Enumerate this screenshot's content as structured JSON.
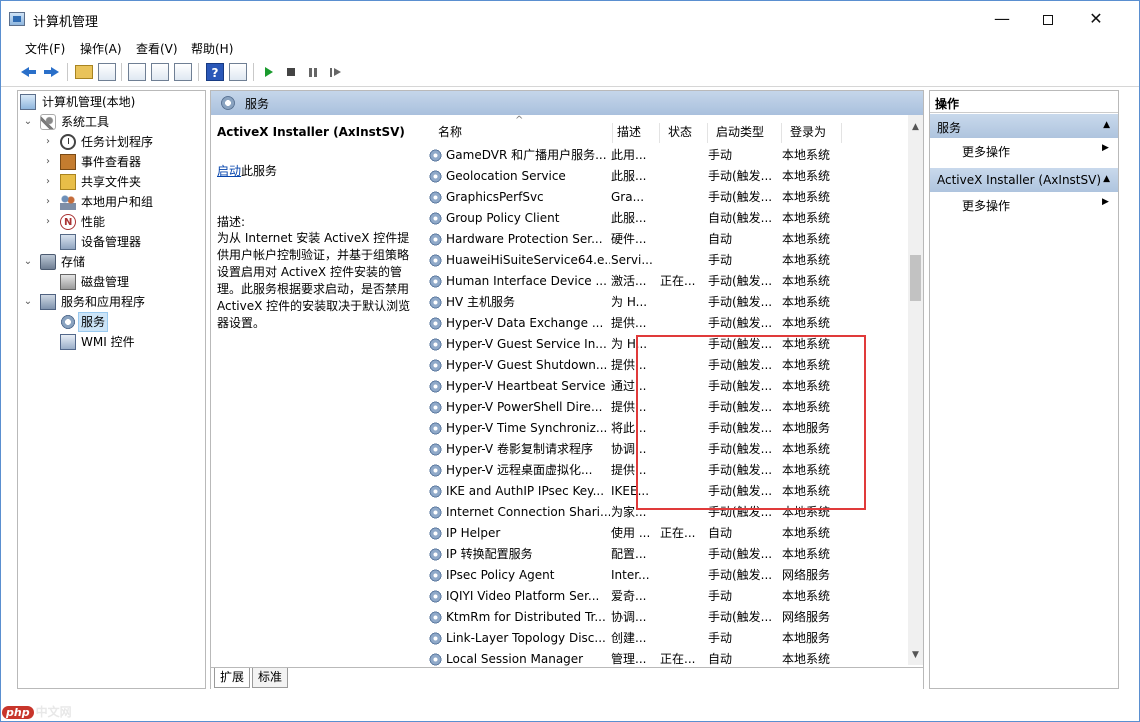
{
  "window": {
    "title": "计算机管理",
    "min_label": "—",
    "close_label": "✕"
  },
  "menu": [
    "文件(F)",
    "操作(A)",
    "查看(V)",
    "帮助(H)"
  ],
  "toolbar": {
    "help_label": "?"
  },
  "tree": [
    {
      "label": "计算机管理(本地)",
      "icon": "computer-icon"
    },
    {
      "label": "系统工具",
      "icon": "tools-icon",
      "arrow": "⌄"
    },
    {
      "label": "任务计划程序",
      "icon": "clock-icon",
      "arrow": "›"
    },
    {
      "label": "事件查看器",
      "icon": "event-icon",
      "arrow": "›"
    },
    {
      "label": "共享文件夹",
      "icon": "folder-icon",
      "arrow": "›"
    },
    {
      "label": "本地用户和组",
      "icon": "users-icon",
      "arrow": "›"
    },
    {
      "label": "性能",
      "icon": "performance-icon",
      "arrow": "›"
    },
    {
      "label": "设备管理器",
      "icon": "device-manager-icon"
    },
    {
      "label": "存储",
      "icon": "storage-icon",
      "arrow": "⌄"
    },
    {
      "label": "磁盘管理",
      "icon": "disk-icon"
    },
    {
      "label": "服务和应用程序",
      "icon": "apps-icon",
      "arrow": "⌄"
    },
    {
      "label": "服务",
      "icon": "services-gear-icon"
    },
    {
      "label": "WMI 控件",
      "icon": "wmi-icon"
    }
  ],
  "center": {
    "header": "服务",
    "selected_service": "ActiveX Installer (AxInstSV)",
    "start_link": "启动",
    "start_suffix": "此服务",
    "desc_label": "描述:",
    "desc_text": "为从 Internet 安装 ActiveX 控件提供用户帐户控制验证，并基于组策略设置启用对 ActiveX 控件安装的管理。此服务根据要求启动，是否禁用 ActiveX 控件的安装取决于默认浏览器设置。"
  },
  "columns": {
    "name": "名称",
    "desc": "描述",
    "state": "状态",
    "start": "启动类型",
    "logon": "登录为",
    "sort": "^"
  },
  "services": [
    [
      "GameDVR 和广播用户服务...",
      "此用...",
      "",
      "手动",
      "本地系统"
    ],
    [
      "Geolocation Service",
      "此服...",
      "",
      "手动(触发...",
      "本地系统"
    ],
    [
      "GraphicsPerfSvc",
      "Gra...",
      "",
      "手动(触发...",
      "本地系统"
    ],
    [
      "Group Policy Client",
      "此服...",
      "",
      "自动(触发...",
      "本地系统"
    ],
    [
      "Hardware Protection Ser...",
      "硬件...",
      "",
      "自动",
      "本地系统"
    ],
    [
      "HuaweiHiSuiteService64.e...",
      "Servi...",
      "",
      "手动",
      "本地系统"
    ],
    [
      "Human Interface Device ...",
      "激活...",
      "正在...",
      "手动(触发...",
      "本地系统"
    ],
    [
      "HV 主机服务",
      "为 H...",
      "",
      "手动(触发...",
      "本地系统"
    ],
    [
      "Hyper-V Data Exchange ...",
      "提供...",
      "",
      "手动(触发...",
      "本地系统"
    ],
    [
      "Hyper-V Guest Service In...",
      "为 H...",
      "",
      "手动(触发...",
      "本地系统"
    ],
    [
      "Hyper-V Guest Shutdown...",
      "提供...",
      "",
      "手动(触发...",
      "本地系统"
    ],
    [
      "Hyper-V Heartbeat Service",
      "通过...",
      "",
      "手动(触发...",
      "本地系统"
    ],
    [
      "Hyper-V PowerShell Dire...",
      "提供...",
      "",
      "手动(触发...",
      "本地系统"
    ],
    [
      "Hyper-V Time Synchroniz...",
      "将此...",
      "",
      "手动(触发...",
      "本地服务"
    ],
    [
      "Hyper-V 卷影复制请求程序",
      "协调...",
      "",
      "手动(触发...",
      "本地系统"
    ],
    [
      "Hyper-V 远程桌面虚拟化...",
      "提供...",
      "",
      "手动(触发...",
      "本地系统"
    ],
    [
      "IKE and AuthIP IPsec Key...",
      "IKEE...",
      "",
      "手动(触发...",
      "本地系统"
    ],
    [
      "Internet Connection Shari...",
      "为家...",
      "",
      "手动(触发...",
      "本地系统"
    ],
    [
      "IP Helper",
      "使用 ...",
      "正在...",
      "自动",
      "本地系统"
    ],
    [
      "IP 转换配置服务",
      "配置...",
      "",
      "手动(触发...",
      "本地系统"
    ],
    [
      "IPsec Policy Agent",
      "Inter...",
      "",
      "手动(触发...",
      "网络服务"
    ],
    [
      "IQIYI Video Platform Ser...",
      "爱奇...",
      "",
      "手动",
      "本地系统"
    ],
    [
      "KtmRm for Distributed Tr...",
      "协调...",
      "",
      "手动(触发...",
      "网络服务"
    ],
    [
      "Link-Layer Topology Disc...",
      "创建...",
      "",
      "手动",
      "本地服务"
    ],
    [
      "Local Session Manager",
      "管理...",
      "正在...",
      "自动",
      "本地系统"
    ]
  ],
  "tabs": [
    "扩展",
    "标准"
  ],
  "actions": {
    "header": "操作",
    "section1": "服务",
    "section2": "ActiveX Installer (AxInstSV)",
    "more": "更多操作",
    "caret_up": "▲",
    "more_arrow": "▶"
  },
  "watermark": {
    "badge": "php",
    "name": "中文网"
  },
  "colors": {
    "accent": "#5a8fd0",
    "highlight": "#e03a3a",
    "header_bg": "#aec4de"
  }
}
